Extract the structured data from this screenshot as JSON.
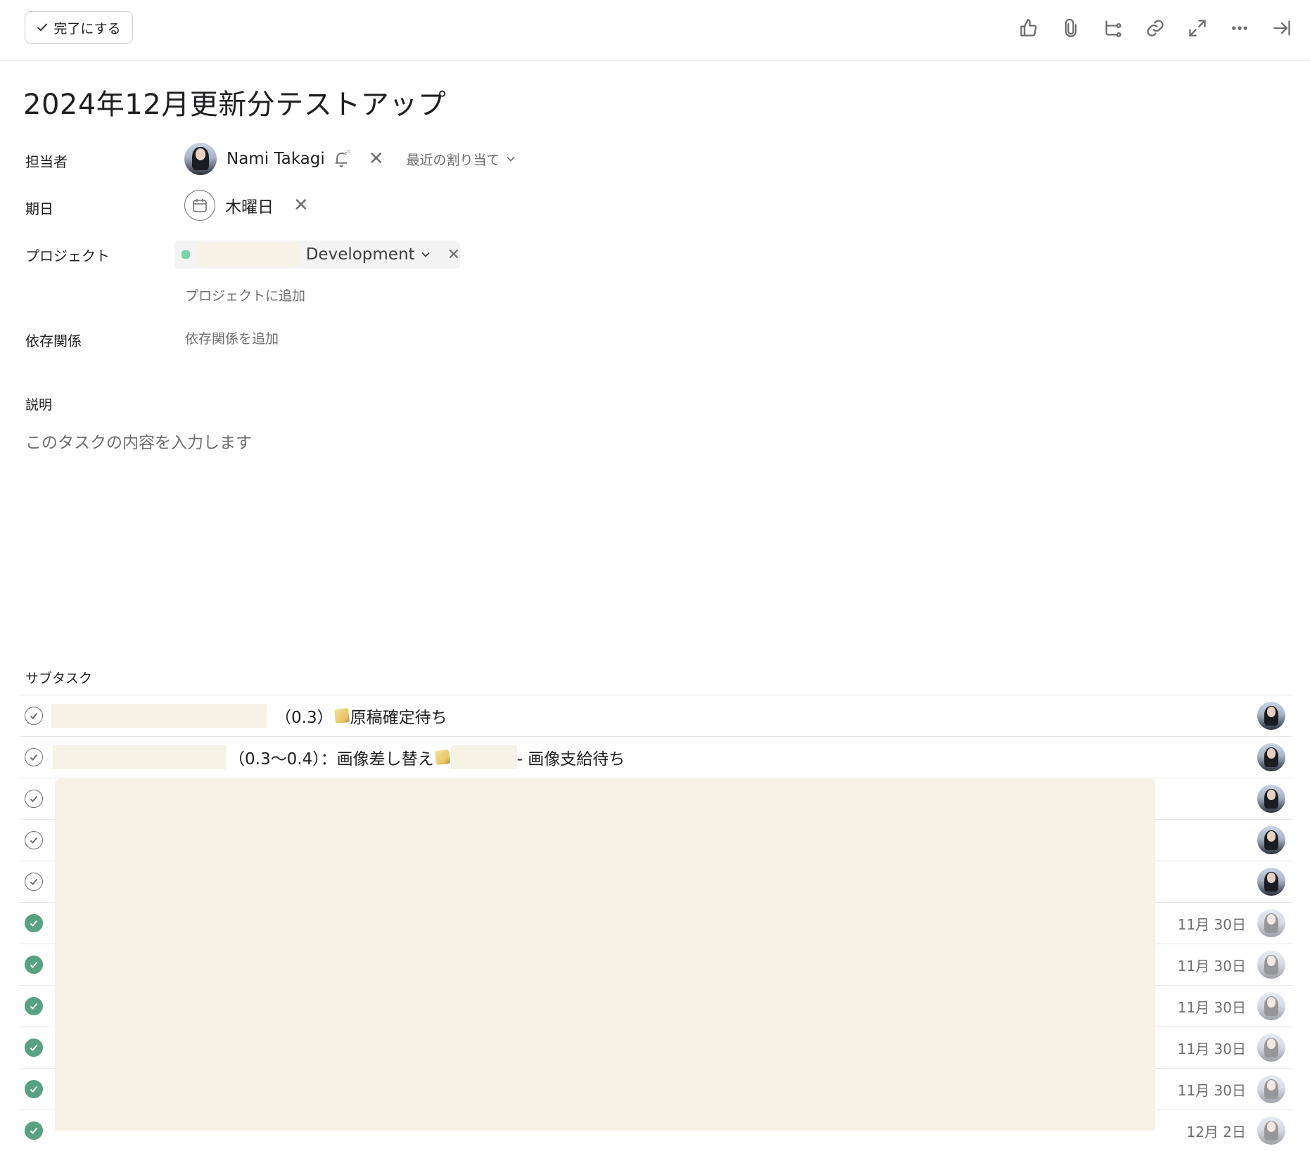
{
  "toolbar": {
    "complete_label": "完了にする",
    "icons": [
      "thumbs-up-icon",
      "attachment-icon",
      "subtask-icon",
      "link-icon",
      "expand-icon",
      "more-icon",
      "close-panel-icon"
    ]
  },
  "task": {
    "title": "2024年12月更新分テストアップ"
  },
  "fields": {
    "assignee_label": "担当者",
    "assignee_name": "Nami Takagi",
    "recent_assignments": "最近の割り当て",
    "due_label": "期日",
    "due_value": "木曜日",
    "project_label": "プロジェクト",
    "project_name": "Development",
    "project_color": "#7bd3a8",
    "add_to_project": "プロジェクトに追加",
    "dependencies_label": "依存関係",
    "add_dependency": "依存関係を追加"
  },
  "description": {
    "label": "説明",
    "placeholder": "このタスクの内容を入力します"
  },
  "subtasks": {
    "label": "サブタスク",
    "rows": [
      {
        "text": "（0.3）",
        "tail": "原稿確定待ち",
        "done": false,
        "date": ""
      },
      {
        "text": "（0.3〜0.4）：画像差し替え",
        "tail": " - 画像支給待ち",
        "done": false,
        "date": ""
      },
      {
        "text": "",
        "tail": "",
        "done": false,
        "date": ""
      },
      {
        "text": "",
        "tail": "",
        "done": false,
        "date": ""
      },
      {
        "text": "",
        "tail": "",
        "done": false,
        "date": ""
      },
      {
        "text": "",
        "tail": "",
        "done": true,
        "date": "11月 30日"
      },
      {
        "text": "",
        "tail": "",
        "done": true,
        "date": "11月 30日"
      },
      {
        "text": "",
        "tail": "",
        "done": true,
        "date": "11月 30日"
      },
      {
        "text": "",
        "tail": "",
        "done": true,
        "date": "11月 30日"
      },
      {
        "text": "",
        "tail": "",
        "done": true,
        "date": "11月 30日"
      },
      {
        "text": "",
        "tail": "",
        "done": true,
        "date": "12月 2日"
      }
    ]
  }
}
